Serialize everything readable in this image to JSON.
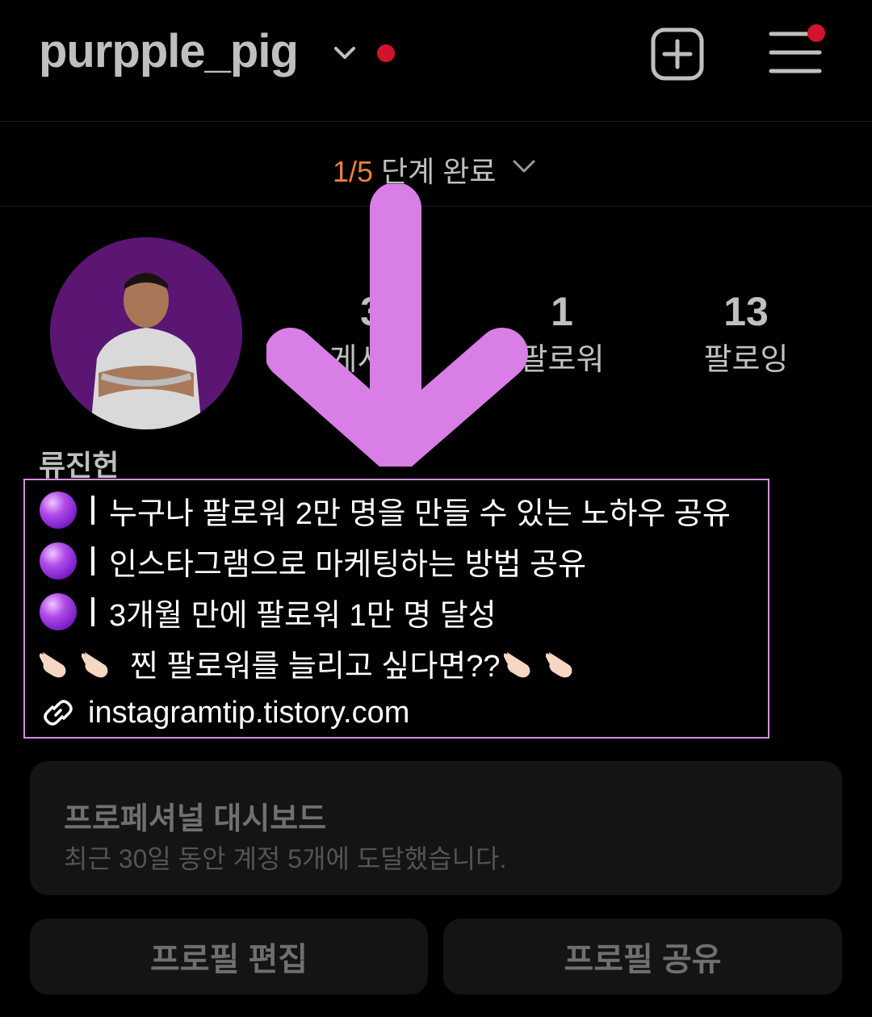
{
  "header": {
    "username": "purpple_pig",
    "icons": [
      "chevron-down-icon",
      "plus-square-icon",
      "hamburger-menu-icon"
    ]
  },
  "progress": {
    "count": "1/5",
    "label": " 단계 완료"
  },
  "profile": {
    "stats": [
      {
        "number": "3",
        "label": "게시물"
      },
      {
        "number": "1",
        "label": "팔로워"
      },
      {
        "number": "13",
        "label": "팔로잉"
      }
    ],
    "display_name": "류진헌"
  },
  "bio": {
    "lines": [
      "누구나 팔로워 2만 명을 만들 수 있는 노하우 공유",
      "인스타그램으로 마케팅하는 방법 공유",
      "3개월 만에 팔로워 1만 명 달성",
      "찐 팔로워를 늘리고 싶다면??"
    ],
    "link": "instagramtip.tistory.com"
  },
  "dashboard": {
    "title": "프로페셔널 대시보드",
    "subtitle": "최근 30일 동안 계정 5개에 도달했습니다."
  },
  "buttons": {
    "edit": "프로필 편집",
    "share": "프로필 공유"
  },
  "colors": {
    "accent_arrow": "#d97ee6",
    "bio_border": "#d58fe1",
    "notif_red": "#d1132c",
    "progress_orange": "#e8823d"
  }
}
